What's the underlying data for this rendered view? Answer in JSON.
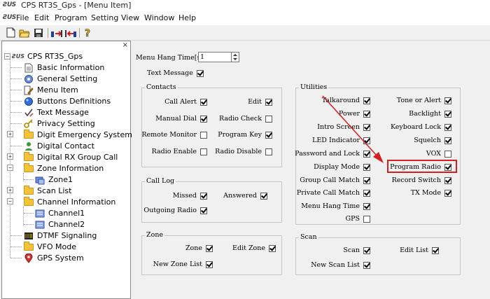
{
  "app": {
    "logo": "ƧUS",
    "title": "CPS RT3S_Gps - [Menu Item]"
  },
  "menu": [
    "File",
    "Edit",
    "Program",
    "Setting",
    "View",
    "Window",
    "Help"
  ],
  "toolbar": [
    "new-icon",
    "open-icon",
    "save-icon",
    "read-radio-icon",
    "write-radio-icon",
    "help-icon"
  ],
  "tree": {
    "close": "×",
    "root": "CPS RT3S_Gps",
    "root_logo": "ƧUS",
    "items": {
      "basic": "Basic Information",
      "general": "General Setting",
      "menu_item": "Menu Item",
      "buttons": "Buttons Definitions",
      "text_msg": "Text Message",
      "privacy": "Privacy Setting",
      "digit_emg": "Digit Emergency System",
      "digital_contact": "Digital Contact",
      "rx_group": "Digital RX Group Call",
      "zone_info": "Zone Information",
      "zone1": "Zone1",
      "scan_list": "Scan List",
      "channel_info": "Channel Information",
      "channel1": "Channel1",
      "channel2": "Channel2",
      "dtmf": "DTMF Signaling",
      "vfo": "VFO Mode",
      "gps": "GPS System"
    }
  },
  "top": {
    "hang_time_label": "Menu Hang Time[s]",
    "hang_time_value": "1",
    "text_message_label": "Text Message",
    "text_message_checked": true
  },
  "contacts": {
    "title": "Contacts",
    "call_alert": "Call Alert",
    "call_alert_checked": true,
    "edit": "Edit",
    "edit_checked": true,
    "manual_dial": "Manual Dial",
    "manual_dial_checked": true,
    "radio_check": "Radio Check",
    "radio_check_checked": false,
    "remote_monitor": "Remote Monitor",
    "remote_monitor_checked": false,
    "program_key": "Program Key",
    "program_key_checked": true,
    "radio_enable": "Radio Enable",
    "radio_enable_checked": false,
    "radio_disable": "Radio Disable",
    "radio_disable_checked": false
  },
  "call_log": {
    "title": "Call Log",
    "missed": "Missed",
    "missed_checked": true,
    "answered": "Answered",
    "answered_checked": true,
    "outgoing": "Outgoing Radio",
    "outgoing_checked": true
  },
  "zone": {
    "title": "Zone",
    "zone": "Zone",
    "zone_checked": true,
    "edit_zone": "Edit Zone",
    "edit_zone_checked": true,
    "new_zone_list": "New Zone List",
    "new_zone_list_checked": true
  },
  "utilities": {
    "title": "Utilities",
    "talkaround": "Talkaround",
    "talkaround_checked": true,
    "tone_alert": "Tone or Alert",
    "tone_alert_checked": true,
    "power": "Power",
    "power_checked": true,
    "backlight": "Backlight",
    "backlight_checked": true,
    "intro_screen": "Intro Screen",
    "intro_screen_checked": true,
    "keyboard_lock": "Keyboard Lock",
    "keyboard_lock_checked": true,
    "led": "LED Indicator",
    "led_checked": true,
    "squelch": "Squelch",
    "squelch_checked": true,
    "password_lock": "Password and Lock",
    "password_lock_checked": true,
    "vox": "VOX",
    "vox_checked": false,
    "display_mode": "Display Mode",
    "display_mode_checked": true,
    "program_radio": "Program Radio",
    "program_radio_checked": true,
    "group_call_match": "Group Call Match",
    "group_call_match_checked": true,
    "record_switch": "Record Switch",
    "record_switch_checked": true,
    "private_call_match": "Private Call Match",
    "private_call_match_checked": true,
    "tx_mode": "TX Mode",
    "tx_mode_checked": true,
    "menu_hang_time": "Menu Hang Time",
    "menu_hang_time_checked": true,
    "gps": "GPS",
    "gps_checked": false
  },
  "scan": {
    "title": "Scan",
    "scan": "Scan",
    "scan_checked": true,
    "edit_list": "Edit List",
    "edit_list_checked": true,
    "new_scan_list": "New Scan List",
    "new_scan_list_checked": true
  },
  "annotation": {
    "color": "#d61f1f"
  }
}
